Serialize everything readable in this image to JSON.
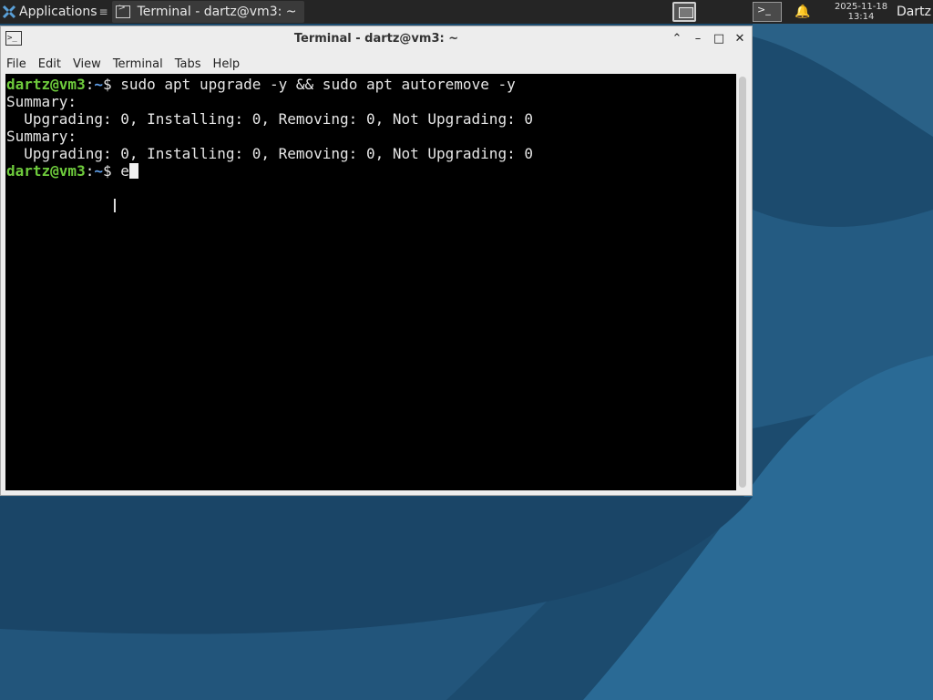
{
  "panel": {
    "applications_label": "Applications",
    "applications_caret": "≡",
    "task_title": "Terminal - dartz@vm3: ~",
    "clock_date": "2025-11-18",
    "clock_time": "13:14",
    "user": "Dartz"
  },
  "window": {
    "title": "Terminal - dartz@vm3: ~",
    "menu": [
      "File",
      "Edit",
      "View",
      "Terminal",
      "Tabs",
      "Help"
    ],
    "controls": {
      "up": "⌃",
      "minimize": "–",
      "maximize": "□",
      "close": "✕"
    }
  },
  "terminal": {
    "prompt_user": "dartz@vm3",
    "prompt_sep": ":",
    "prompt_path": "~",
    "prompt_end": "$ ",
    "command": "sudo apt upgrade -y && sudo apt autoremove -y",
    "output": [
      "Summary:",
      "  Upgrading: 0, Installing: 0, Removing: 0, Not Upgrading: 0",
      "Summary:",
      "  Upgrading: 0, Installing: 0, Removing: 0, Not Upgrading: 0"
    ],
    "current_input": "e"
  },
  "colors": {
    "desktop": "#1d4f74",
    "panel": "#252525",
    "prompt_user": "#6ecb3c",
    "prompt_path": "#5f9ee8"
  },
  "icons": [
    "applications-menu-icon",
    "terminal-icon",
    "workspace-switcher-icon",
    "notification-bell-icon"
  ]
}
